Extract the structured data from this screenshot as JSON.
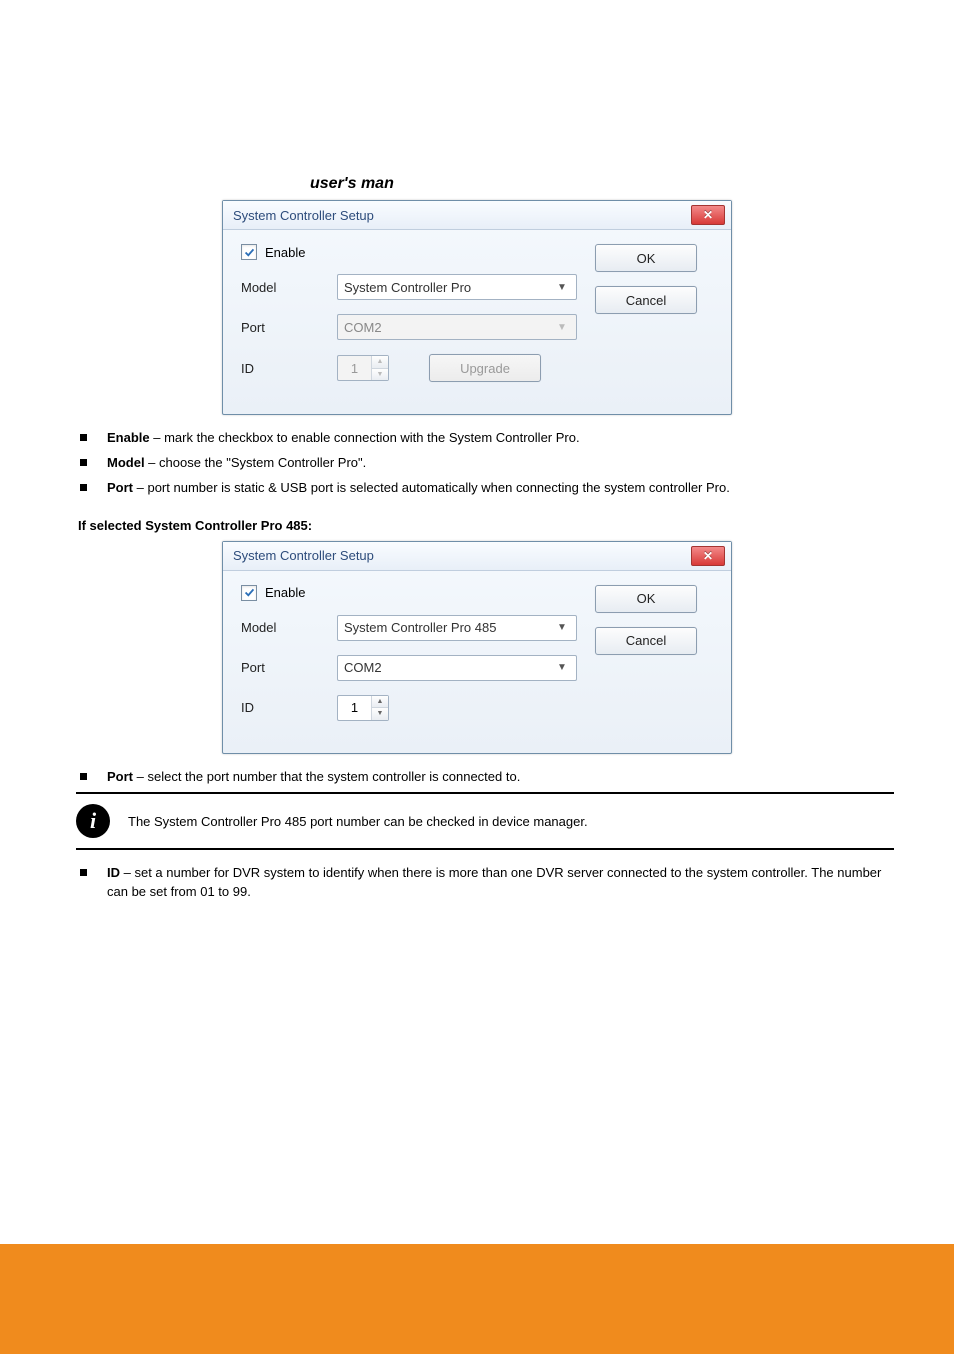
{
  "top_italic": "user's man",
  "dialog1": {
    "title": "System Controller Setup",
    "enable_label": "Enable",
    "enable_checked": true,
    "model_label": "Model",
    "model_value": "System Controller Pro",
    "port_label": "Port",
    "port_value": "COM2",
    "port_disabled": true,
    "id_label": "ID",
    "id_value": "1",
    "id_disabled": true,
    "upgrade_label": "Upgrade",
    "upgrade_disabled": true,
    "ok_label": "OK",
    "cancel_label": "Cancel"
  },
  "bullets1": [
    {
      "bold": "Enable",
      "dash": " – ",
      "text": "mark the checkbox to enable connection with the System Controller Pro."
    },
    {
      "bold": "Model",
      "dash": " – ",
      "text": "choose the \"System Controller Pro\"."
    },
    {
      "bold": "Port",
      "dash": " – ",
      "text": "port number is static & USB port is selected automatically when connecting the system controller Pro."
    }
  ],
  "condition_title": "If selected System Controller Pro 485:",
  "dialog2": {
    "title": "System Controller Setup",
    "enable_label": "Enable",
    "enable_checked": true,
    "model_label": "Model",
    "model_value": "System Controller Pro 485",
    "port_label": "Port",
    "port_value": "COM2",
    "port_disabled": false,
    "id_label": "ID",
    "id_value": "1",
    "id_disabled": false,
    "ok_label": "OK",
    "cancel_label": "Cancel"
  },
  "bullets2a": [
    {
      "bold": "Port",
      "dash": " – ",
      "text": "select the port number that the system controller is connected to."
    }
  ],
  "info_note": "The System Controller Pro 485 port number can be checked in device manager.",
  "bullets2b": [
    {
      "bold": "ID",
      "dash": " – ",
      "text": "set a number for DVR system to identify when there is more than one DVR server connected to the system controller. The number can be set from 01 to 99."
    }
  ]
}
